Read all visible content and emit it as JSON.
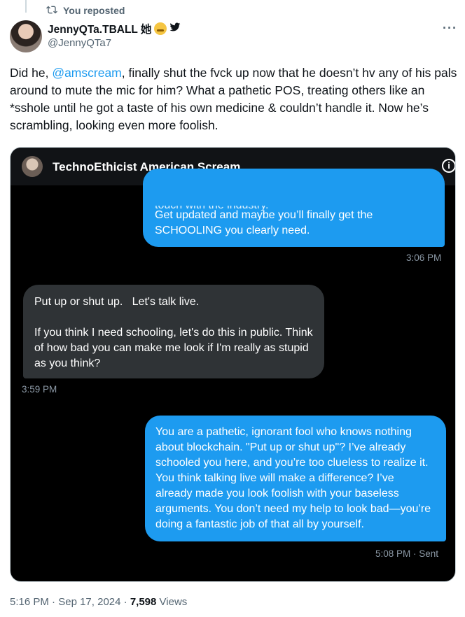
{
  "repost": {
    "label": "You reposted",
    "icon": "repost-icon"
  },
  "author": {
    "display_name": "JennyQTa.TBALL 她",
    "handle": "@JennyQTa7",
    "emoji": "smiling-face-icon",
    "badge": "bird-icon"
  },
  "tweet": {
    "text_before": "Did he, ",
    "mention": "@amscream",
    "text_after": ", finally shut the fvck up now that he doesn’t hv any of his pals around to mute the mic for him? What a pathetic POS, treating others like an *sshole until he got a taste of his own medicine & couldn’t handle it. Now he’s scrambling, looking even more foolish."
  },
  "dm": {
    "title": "TechnoEthicist American Scream",
    "messages": [
      {
        "clipped": "touch with the industry.",
        "text": "Get updated and maybe you’ll finally get the SCHOOLING you clearly need.",
        "time": "3:06 PM"
      },
      {
        "line1": "Put up or shut up.   Let's talk live.",
        "line2": "If you think I need schooling, let's do this in public. Think of how bad you can make me look if I'm really as stupid as you think?",
        "time": "3:59 PM"
      },
      {
        "text": "You are a pathetic, ignorant fool who knows nothing about blockchain. \"Put up or shut up\"? I’ve already schooled you here, and you’re too clueless to realize it. You think talking live will make a difference? I’ve already made you look foolish with your baseless arguments. You don’t need my help to look bad—you’re doing a fantastic job of that all by yourself.",
        "time": "5:08 PM · Sent"
      }
    ]
  },
  "meta": {
    "time": "5:16 PM",
    "date": "Sep 17, 2024",
    "views_count": "7,598",
    "views_label": "Views"
  },
  "colors": {
    "accent": "#1d9bf0",
    "received": "#2f3336",
    "muted": "#536471"
  }
}
